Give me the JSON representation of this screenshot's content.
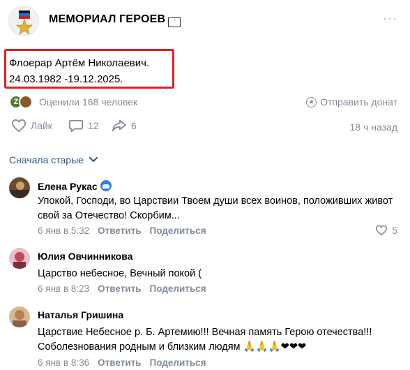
{
  "group": {
    "name": "МЕМОРИАЛ ГЕРОЕВ",
    "more_label": "···"
  },
  "post": {
    "line1": "Флоерар Артём Николаевич.",
    "line2": "24.03.1982 -19.12.2025."
  },
  "reactions": {
    "liked_text": "Оценили 168 человек",
    "donate_label": "Отправить донат"
  },
  "actions": {
    "like_label": "Лайк",
    "comments_count": "12",
    "shares_count": "6",
    "time_ago": "18 ч назад"
  },
  "sort": {
    "label": "Сначала старые"
  },
  "comments": [
    {
      "author": "Елена Рукас",
      "text": "Упокой, Господи, во Царствии Твоем души всех воинов, положивших живот свой за Отечество! Скорбим...",
      "date": "6 янв в 5:32",
      "reply_label": "Ответить",
      "share_label": "Поделиться",
      "likes": "5"
    },
    {
      "author": "Юлия Овчинникова",
      "text": "Царство небесное, Вечный покой (",
      "date": "6 янв в 8:23",
      "reply_label": "Ответить",
      "share_label": "Поделиться"
    },
    {
      "author": "Наталья Гришина",
      "text_line1": "Царствие Небесное р. Б. Артемию!!! Вечная память Герою отечества!!!",
      "text_line2": "Соболезнования родным и близким людям",
      "emojis": "🙏🙏🙏❤❤❤",
      "date": "6 янв в 8:36",
      "reply_label": "Ответить",
      "share_label": "Поделиться"
    }
  ],
  "colors": {
    "accent_link": "#2a5885",
    "secondary_text": "#818c99",
    "highlight_border": "#e02020",
    "badge_blue": "#2d81e0"
  },
  "icons": {
    "avatar": "gold-star-avatar",
    "like": "heart-icon",
    "comment": "comment-bubble-icon",
    "share": "share-arrow-icon",
    "donate": "star-circle-icon",
    "sort": "chevron-down-icon"
  }
}
